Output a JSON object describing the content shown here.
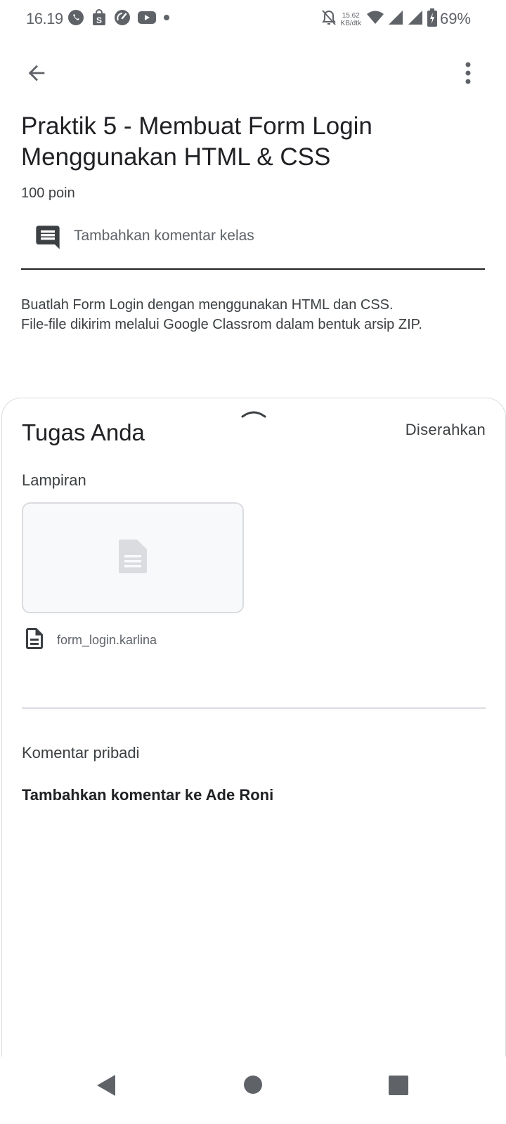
{
  "status_bar": {
    "time": "16.19",
    "net_speed_value": "15.62",
    "net_speed_unit": "KB/dtk",
    "battery": "69%",
    "left_icons": [
      "whatsapp-icon",
      "shopping-bag-icon",
      "speedometer-icon",
      "youtube-icon",
      "dot-icon"
    ],
    "right_icons": [
      "silent-icon",
      "wifi-icon",
      "signal-icon",
      "signal-icon",
      "battery-charging-icon"
    ]
  },
  "app_bar": {
    "back_icon": "arrow-back-icon",
    "more_icon": "more-vert-icon"
  },
  "assignment": {
    "title": "Praktik 5 - Membuat Form Login Menggunakan HTML & CSS",
    "points": "100 poin",
    "class_comment_placeholder": "Tambahkan komentar kelas",
    "description_line1": "Buatlah Form Login dengan menggunakan HTML dan CSS.",
    "description_line2": "File-file dikirim melalui Google Classrom dalam bentuk arsip ZIP."
  },
  "your_work": {
    "title": "Tugas Anda",
    "status": "Diserahkan",
    "attachments_label": "Lampiran",
    "file_name": "form_login.karlina",
    "private_comment_label": "Komentar pribadi",
    "private_comment_add": "Tambahkan komentar ke Ade Roni"
  },
  "colors": {
    "text_primary": "#202124",
    "text_secondary": "#5f6368",
    "divider": "#dadce0",
    "thumb_bg": "#f8f9fa"
  }
}
